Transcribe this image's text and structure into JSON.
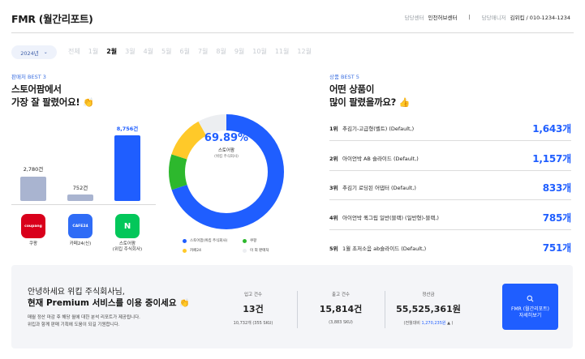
{
  "header": {
    "title": "FMR (월간리포트)",
    "center_label": "담당센터",
    "center_value": "인천허브센터",
    "manager_label": "담당매니저",
    "manager_value": "김위킵 / 010-1234-1234"
  },
  "filter": {
    "year": "2024년",
    "months": [
      "전체",
      "1월",
      "2월",
      "3월",
      "4월",
      "5월",
      "6월",
      "7월",
      "8월",
      "9월",
      "10월",
      "11월",
      "12월"
    ],
    "active_month": "2월"
  },
  "channels": {
    "kicker": "판매처 BEST 3",
    "title_line1": "스토어팜에서",
    "title_line2": "가장 잘 팔렸어요!",
    "items": [
      {
        "name": "쿠팡",
        "value": "2,780건",
        "amount": 2780,
        "logo_text": "coupang",
        "color": "#d9001b"
      },
      {
        "name": "카페24(신)",
        "value": "752건",
        "amount": 752,
        "logo_text": "CAFE24",
        "color": "#2f6cf6"
      },
      {
        "name": "스토어팜",
        "name2": "(위킵 주식회사)",
        "value": "8,756건",
        "amount": 8756,
        "logo_text": "N",
        "color": "#03c75a"
      }
    ]
  },
  "donut": {
    "percent": "69.89%",
    "label1": "스토어팜",
    "label2": "(위킵 주식회사)",
    "segments": [
      {
        "name": "스토어팜(위킵 주식회사)",
        "share": 0.6989,
        "color": "#1f5eff"
      },
      {
        "name": "쿠팡",
        "share": 0.1,
        "color": "#2db82d"
      },
      {
        "name": "카페24",
        "share": 0.12,
        "color": "#ffc929"
      },
      {
        "name": "이 외 판매처",
        "share": 0.0811,
        "color": "#eceef1"
      }
    ]
  },
  "products": {
    "kicker": "상품 BEST 5",
    "title_line1": "어떤 상품이",
    "title_line2": "많이 팔렸을까요?",
    "items": [
      {
        "rank": "1위",
        "name": "추김기-고급형(벨트) (Default,)",
        "count": "1,643개"
      },
      {
        "rank": "2위",
        "name": "아이언박 AB 슬라이드 (Default,)",
        "count": "1,157개"
      },
      {
        "rank": "3위",
        "name": "추김기 로딩된 어댑터 (Default,)",
        "count": "833개"
      },
      {
        "rank": "4위",
        "name": "아이언박 퀵그립 일반(블랙) (일반형)-블랙,)",
        "count": "785개"
      },
      {
        "rank": "5위",
        "name": "1월 초저소음 ab슬라이드 (Default,)",
        "count": "751개"
      }
    ]
  },
  "summary": {
    "greet1": "안녕하세요 위킵 주식회사님,",
    "greet2": "현재 Premium 서비스를 이용 중이세요",
    "note1": "매월 정산 마감 후 해당 월에 대한 분석 리포트가 제공됩니다.",
    "note2": "위킵과 함께 판매 기획에 도움이 되길 기원합니다.",
    "stats": [
      {
        "label": "입고 건수",
        "value": "13건",
        "sub": "10,732개 (355 SKU)"
      },
      {
        "label": "출고 건수",
        "value": "15,814건",
        "sub": "(3,883 SKU)"
      },
      {
        "label": "정산금",
        "value": "55,525,361원",
        "sub_prefix": "(전월대비 ",
        "sub_highlight": "1,270,235원",
        "sub_suffix": " ▲ )"
      }
    ],
    "cta_line1": "FMR (월간리포트)",
    "cta_line2": "자세히보기"
  },
  "colors": {
    "accent": "#1f5eff",
    "gray_bar": "#a9b4d0",
    "panel": "#f4f5f8"
  }
}
